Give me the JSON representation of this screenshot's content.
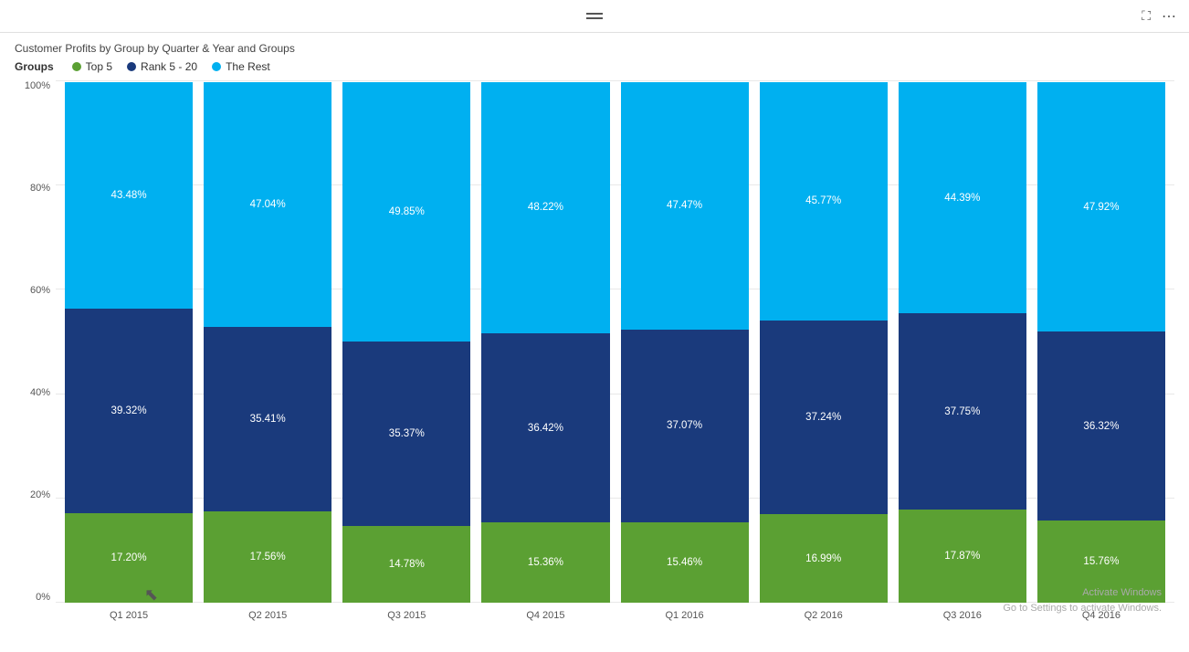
{
  "title": "Customer Profits by Group by Quarter & Year and Groups",
  "topbar": {
    "hamburger_label": "menu",
    "expand_label": "expand",
    "more_label": "more options"
  },
  "legend": {
    "label": "Groups",
    "items": [
      {
        "id": "top5",
        "color": "#5ba033",
        "shape": "circle",
        "label": "Top 5"
      },
      {
        "id": "rank5-20",
        "color": "#1a3a7c",
        "shape": "circle",
        "label": "Rank 5 - 20"
      },
      {
        "id": "the-rest",
        "color": "#00b0f0",
        "shape": "circle",
        "label": "The Rest"
      }
    ]
  },
  "y_axis": {
    "labels": [
      "100%",
      "80%",
      "60%",
      "40%",
      "20%",
      "0%"
    ]
  },
  "bars": [
    {
      "quarter": "Q1 2015",
      "top5": 17.2,
      "rank5_20": 39.32,
      "the_rest": 43.48,
      "labels": {
        "top5": "17.20%",
        "rank5_20": "39.32%",
        "the_rest": "43.48%"
      }
    },
    {
      "quarter": "Q2 2015",
      "top5": 17.56,
      "rank5_20": 35.41,
      "the_rest": 47.04,
      "labels": {
        "top5": "17.56%",
        "rank5_20": "35.41%",
        "the_rest": "47.04%"
      }
    },
    {
      "quarter": "Q3 2015",
      "top5": 14.78,
      "rank5_20": 35.37,
      "the_rest": 49.85,
      "labels": {
        "top5": "14.78%",
        "rank5_20": "35.37%",
        "the_rest": "49.85%"
      }
    },
    {
      "quarter": "Q4 2015",
      "top5": 15.36,
      "rank5_20": 36.42,
      "the_rest": 48.22,
      "labels": {
        "top5": "15.36%",
        "rank5_20": "36.42%",
        "the_rest": "48.22%"
      }
    },
    {
      "quarter": "Q1 2016",
      "top5": 15.46,
      "rank5_20": 37.07,
      "the_rest": 47.47,
      "labels": {
        "top5": "15.46%",
        "rank5_20": "37.07%",
        "the_rest": "47.47%"
      }
    },
    {
      "quarter": "Q2 2016",
      "top5": 16.99,
      "rank5_20": 37.24,
      "the_rest": 45.77,
      "labels": {
        "top5": "16.99%",
        "rank5_20": "37.24%",
        "the_rest": "45.77%"
      }
    },
    {
      "quarter": "Q3 2016",
      "top5": 17.87,
      "rank5_20": 37.75,
      "the_rest": 44.39,
      "labels": {
        "top5": "17.87%",
        "rank5_20": "37.75%",
        "the_rest": "44.39%"
      }
    },
    {
      "quarter": "Q4 2016",
      "top5": 15.76,
      "rank5_20": 36.32,
      "the_rest": 47.92,
      "labels": {
        "top5": "15.76%",
        "rank5_20": "36.32%",
        "the_rest": "47.92%"
      }
    }
  ],
  "watermark": {
    "line1": "Activate Windows",
    "line2": "Go to Settings to activate Windows."
  }
}
